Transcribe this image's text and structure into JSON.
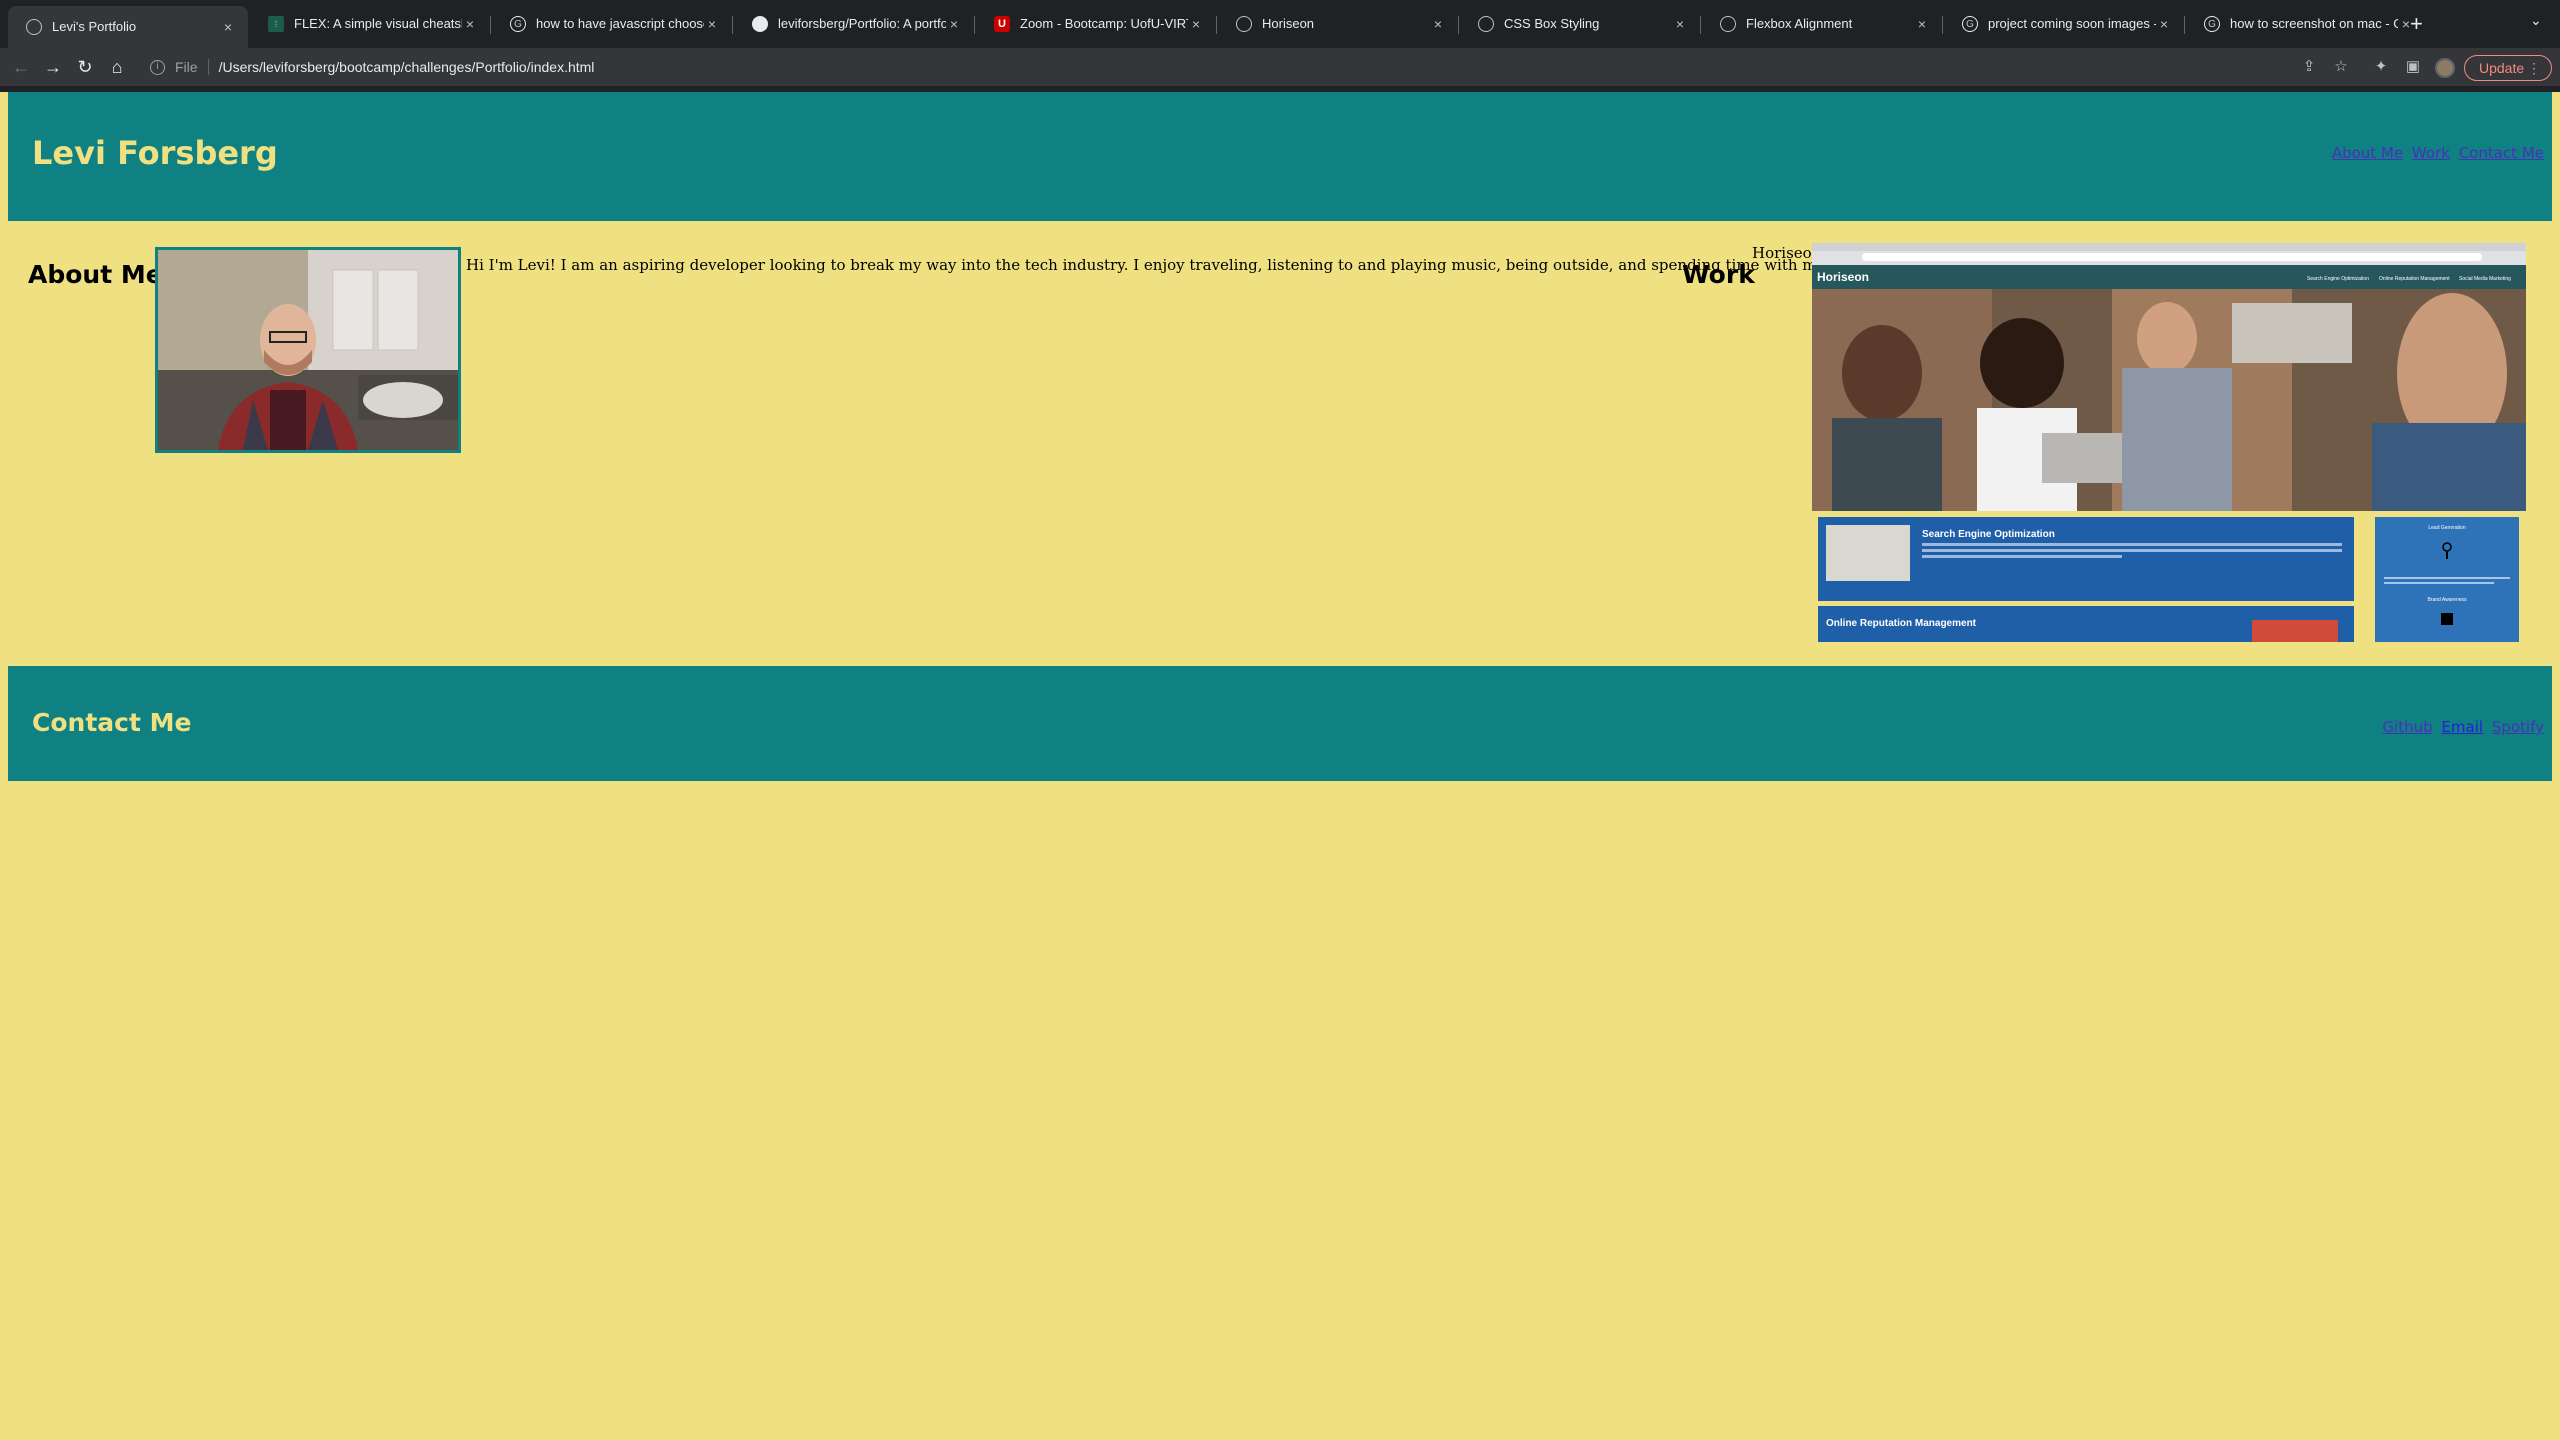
{
  "browser": {
    "tabs": [
      {
        "title": "Levi's Portfolio",
        "icon": "globe-icon",
        "active": true
      },
      {
        "title": "FLEX: A simple visual cheatshe",
        "icon": "flex-icon"
      },
      {
        "title": "how to have javascript choose",
        "icon": "google-icon"
      },
      {
        "title": "leviforsberg/Portfolio: A portfol",
        "icon": "github-icon"
      },
      {
        "title": "Zoom - Bootcamp: UofU-VIRT",
        "icon": "zoom-icon"
      },
      {
        "title": "Horiseon",
        "icon": "globe-icon"
      },
      {
        "title": "CSS Box Styling",
        "icon": "globe-icon"
      },
      {
        "title": "Flexbox Alignment",
        "icon": "globe-icon"
      },
      {
        "title": "project coming soon images - G",
        "icon": "google-icon"
      },
      {
        "title": "how to screenshot on mac - Go",
        "icon": "google-icon"
      }
    ],
    "address": {
      "scheme": "File",
      "url": "/Users/leviforsberg/bootcamp/challenges/Portfolio/index.html"
    },
    "update_label": "Update"
  },
  "page": {
    "name": "Levi Forsberg",
    "nav": [
      "About Me",
      "Work",
      "Contact Me"
    ],
    "about": {
      "heading": "About Me",
      "text": "Hi I'm Levi! I am an aspiring developer looking to break my way into the tech industry. I enjoy traveling, listening to and playing music, being outside, and spending time with my family."
    },
    "work": {
      "heading": "Work",
      "project_caption": "Horiseon",
      "preview": {
        "brand": "Horiseon",
        "nav": [
          "Search Engine Optimization",
          "Online Reputation Management",
          "Social Media Marketing"
        ],
        "cards": [
          "Search Engine Optimization",
          "Online Reputation Management"
        ],
        "aside": [
          "Lead Generation",
          "Brand Awareness"
        ]
      }
    },
    "contact": {
      "heading": "Contact Me",
      "links": [
        "Github",
        "Email",
        "Spotify"
      ]
    }
  },
  "colors": {
    "header_bg": "#108182",
    "page_bg": "#efe082",
    "heading_text": "#efe082"
  }
}
